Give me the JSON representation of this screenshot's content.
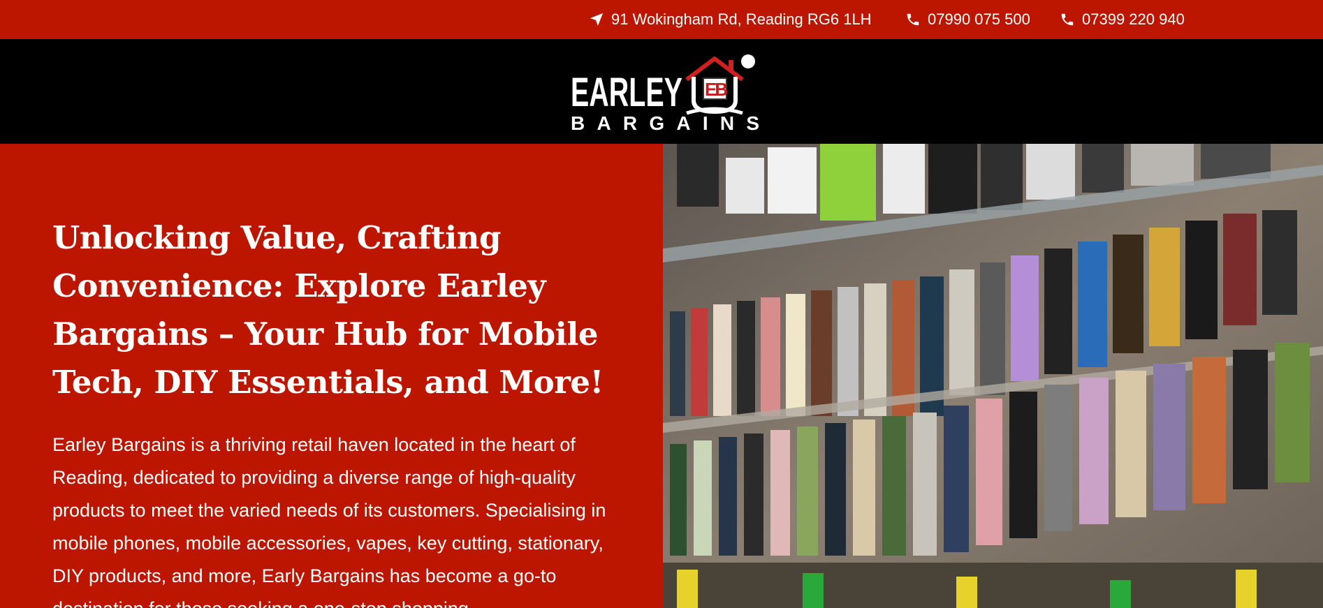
{
  "topbar": {
    "address": "91 Wokingham Rd, Reading RG6 1LH",
    "phone_1": "07990 075 500",
    "phone_2": "07399 220 940"
  },
  "logo": {
    "word_1": "EARLEY",
    "word_2": "BARGAINS",
    "monogram": "EB"
  },
  "hero": {
    "title": "Unlocking Value, Crafting Convenience: Explore Earley Bargains – Your Hub for Mobile Tech, DIY Essentials, and More!",
    "body": "Earley Bargains is a thriving retail haven located in the heart of Reading, dedicated to providing a diverse range of high-quality products to meet the varied needs of its customers. Specialising in mobile phones, mobile accessories, vapes, key cutting, stationary, DIY products, and more, Early Bargains has become a go-to destination for those seeking a one-stop shopping"
  },
  "icons": {
    "address": "location-arrow-icon",
    "phone": "phone-icon"
  },
  "colors": {
    "brand_red": "#bd1600",
    "header_black": "#000000",
    "text": "#ffffff"
  }
}
